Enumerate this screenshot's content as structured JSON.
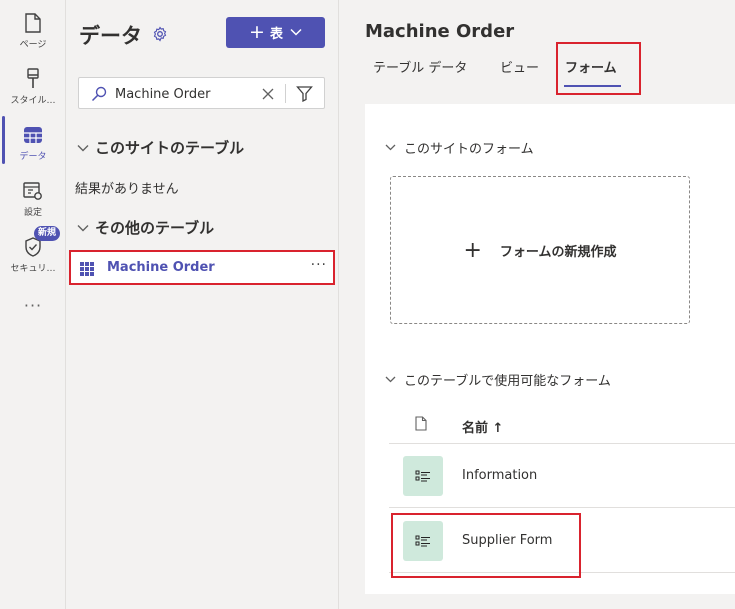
{
  "rail": {
    "items": [
      {
        "label": "ページ",
        "icon": "page-icon"
      },
      {
        "label": "スタイル…",
        "icon": "brush-icon"
      },
      {
        "label": "データ",
        "icon": "table-icon"
      },
      {
        "label": "設定",
        "icon": "settings-icon"
      },
      {
        "label": "セキュリ…",
        "icon": "shield-icon"
      }
    ],
    "new_badge": "新規",
    "more": "···"
  },
  "panel": {
    "title": "データ",
    "add_button_label": "表",
    "search": {
      "value": "Machine Order"
    },
    "sections": {
      "site_tables": "このサイトのテーブル",
      "no_results": "結果がありません",
      "other_tables": "その他のテーブル"
    },
    "tables": [
      {
        "name": "Machine Order"
      }
    ]
  },
  "main": {
    "title": "Machine Order",
    "tabs": [
      {
        "label": "テーブル データ",
        "active": false
      },
      {
        "label": "ビュー",
        "active": false
      },
      {
        "label": "フォーム",
        "active": true
      }
    ],
    "site_forms_header": "このサイトのフォーム",
    "new_form_label": "フォームの新規作成",
    "table_forms_header": "このテーブルで使用可能なフォーム",
    "column_name": "名前 ↑",
    "forms": [
      {
        "name": "Information"
      },
      {
        "name": "Supplier Form"
      }
    ]
  },
  "colors": {
    "accent": "#4f52b2",
    "highlight": "#d9232e",
    "form_icon_bg": "#cfe9dc"
  }
}
